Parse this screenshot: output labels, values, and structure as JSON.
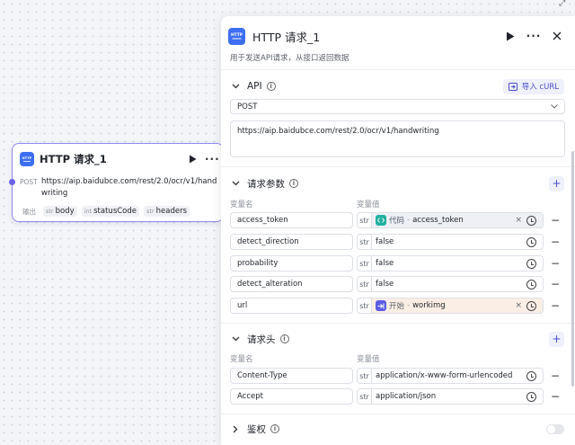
{
  "node": {
    "title": "HTTP 请求_1",
    "method_label": "POST",
    "url": "https://aip.baidubce.com/rest/2.0/ocr/v1/handwriting",
    "output_label": "输出",
    "outputs": [
      {
        "type": "str",
        "name": "body"
      },
      {
        "type": "int",
        "name": "statusCode"
      },
      {
        "type": "str",
        "name": "headers"
      }
    ],
    "badge_text": "HTTP"
  },
  "panel": {
    "title": "HTTP 请求_1",
    "description": "用于发送API请求，从接口返回数据",
    "badge_text": "HTTP",
    "api": {
      "title": "API",
      "import_label": "导入 cURL",
      "method": "POST",
      "url": "https://aip.baidubce.com/rest/2.0/ocr/v1/handwriting"
    },
    "params": {
      "title": "请求参数",
      "col_name": "变量名",
      "col_value": "变量值",
      "rows": [
        {
          "name": "access_token",
          "type": "str",
          "kind": "ref",
          "ref_src": "代码",
          "ref_var": "access_token",
          "ref_color": "#20b0a0"
        },
        {
          "name": "detect_direction",
          "type": "str",
          "kind": "literal",
          "value": "false"
        },
        {
          "name": "probability",
          "type": "str",
          "kind": "literal",
          "value": "false"
        },
        {
          "name": "detect_alteration",
          "type": "str",
          "kind": "literal",
          "value": "false"
        },
        {
          "name": "url",
          "type": "str",
          "kind": "ref",
          "ref_src": "开始",
          "ref_var": "workimg",
          "ref_color": "#5b5ce6"
        }
      ]
    },
    "headers": {
      "title": "请求头",
      "col_name": "变量名",
      "col_value": "变量值",
      "rows": [
        {
          "name": "Content-Type",
          "type": "str",
          "value": "application/x-www-form-urlencoded"
        },
        {
          "name": "Accept",
          "type": "str",
          "value": "application/json"
        }
      ]
    },
    "auth": {
      "title": "鉴权",
      "enabled": false
    }
  },
  "colors": {
    "accent": "#4b4fc4",
    "node_border": "#8f88f2",
    "badge": "#3d6ef2"
  }
}
